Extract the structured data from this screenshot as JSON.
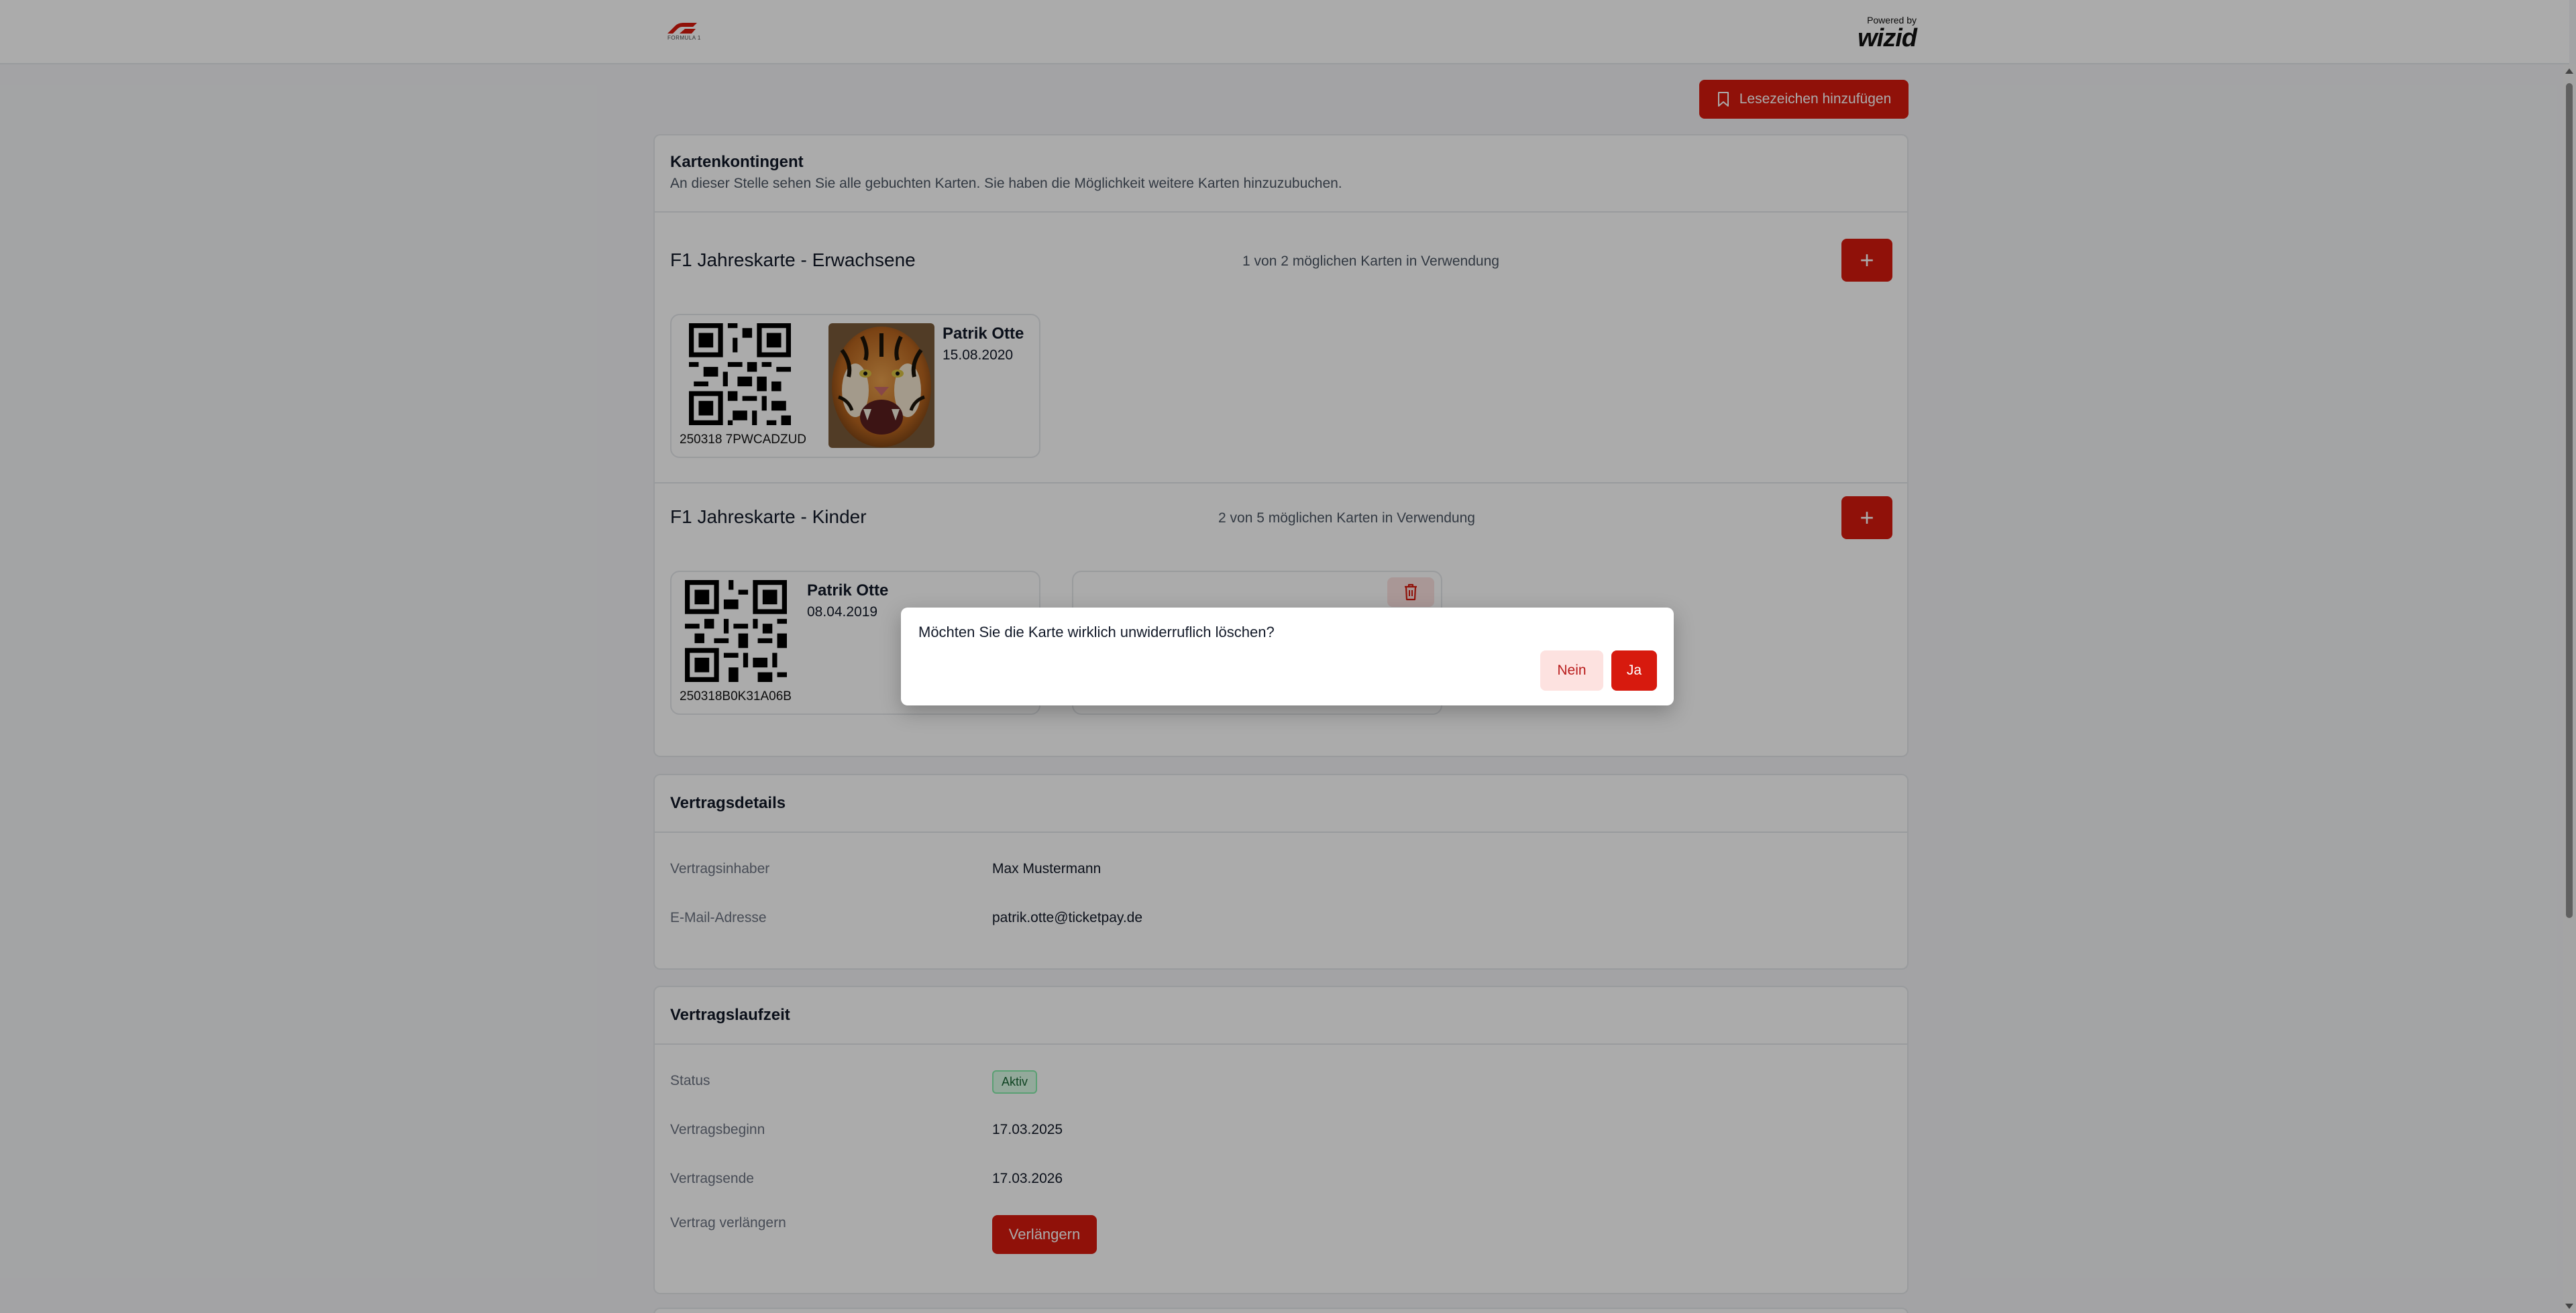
{
  "header": {
    "brand_tag": "FORMULA 1",
    "powered_by": "Powered by",
    "vendor": "wizid"
  },
  "bookmark_button": {
    "label": "Lesezeichen hinzufügen"
  },
  "card_quota": {
    "title": "Kartenkontingent",
    "subtitle": "An dieser Stelle sehen Sie alle gebuchten Karten. Sie haben die Möglichkeit weitere Karten hinzuzubuchen.",
    "sections": [
      {
        "title": "F1 Jahreskarte - Erwachsene",
        "usage": "1 von 2 möglichen Karten in Verwendung",
        "add_label": "+",
        "tickets": [
          {
            "code": "250318 7PWCADZUD",
            "name": "Patrik Otte",
            "date": "15.08.2020"
          }
        ]
      },
      {
        "title": "F1 Jahreskarte - Kinder",
        "usage": "2 von 5 möglichen Karten in Verwendung",
        "add_label": "+",
        "tickets": [
          {
            "code": "250318B0K31A06B",
            "name": "Patrik Otte",
            "date": "08.04.2019"
          }
        ]
      }
    ]
  },
  "contract_details": {
    "title": "Vertragsdetails",
    "rows": [
      {
        "label": "Vertragsinhaber",
        "value": "Max Mustermann"
      },
      {
        "label": "E-Mail-Adresse",
        "value": "patrik.otte@ticketpay.de"
      }
    ]
  },
  "contract_runtime": {
    "title": "Vertragslaufzeit",
    "status_label": "Status",
    "status_value": "Aktiv",
    "start_label": "Vertragsbeginn",
    "start_value": "17.03.2025",
    "end_label": "Vertragsende",
    "end_value": "17.03.2026",
    "renew_label": "Vertrag verlängern",
    "renew_button": "Verlängern"
  },
  "dialog": {
    "message": "Möchten Sie die Karte wirklich unwiderruflich löschen?",
    "no": "Nein",
    "yes": "Ja"
  },
  "colors": {
    "accent": "#d71a0e",
    "accent_soft": "#fde2e0",
    "status_green": "#166534"
  },
  "icons": [
    "f1-logo-icon",
    "bookmark-icon",
    "plus-icon",
    "trash-icon",
    "qr-code-icon"
  ]
}
